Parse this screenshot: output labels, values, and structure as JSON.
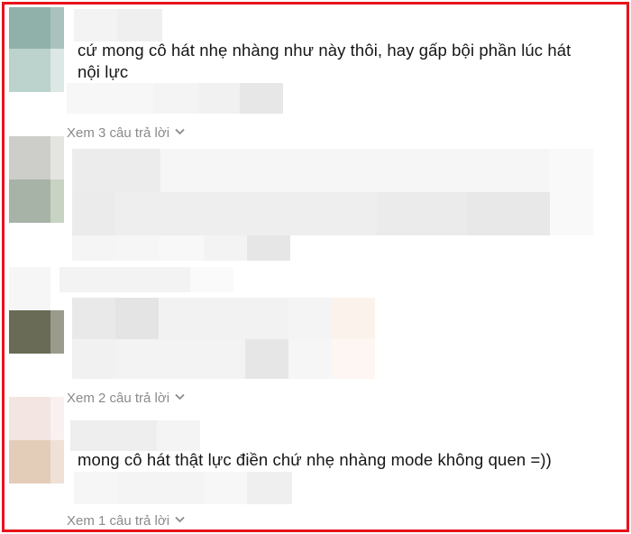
{
  "comments": [
    {
      "text": "cứ mong cô hát nhẹ nhàng như này thôi, hay gấp bội phần lúc hát nội lực",
      "replies_label": "Xem 3 câu trả lời"
    },
    {
      "replies_label": "Xem 2 câu trả lời"
    },
    {
      "text": "mong cô hát thật lực điền chứ nhẹ nhàng mode không quen =))",
      "replies_label": "Xem 1 câu trả lời"
    }
  ],
  "icons": {
    "chevron": "chevron-down-icon"
  },
  "colors": {
    "frame": "#e8121b",
    "text": "#161616",
    "muted": "#8a8a8a"
  }
}
